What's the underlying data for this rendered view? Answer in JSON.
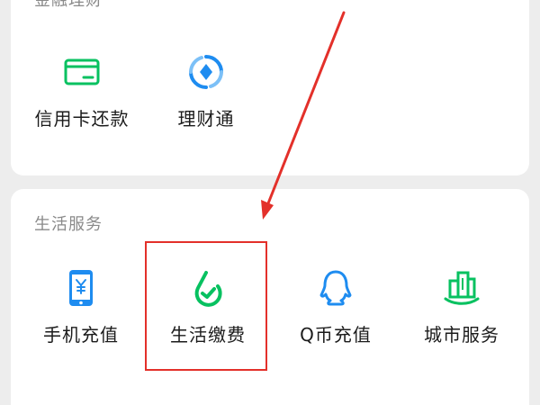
{
  "finance": {
    "title": "金融理财",
    "items": [
      {
        "label": "信用卡还款",
        "icon": "credit-card-icon"
      },
      {
        "label": "理财通",
        "icon": "wealth-icon"
      }
    ]
  },
  "life_services": {
    "title": "生活服务",
    "items": [
      {
        "label": "手机充值",
        "icon": "phone-icon"
      },
      {
        "label": "生活缴费",
        "icon": "bill-pay-icon"
      },
      {
        "label": "Q币充值",
        "icon": "qq-icon"
      },
      {
        "label": "城市服务",
        "icon": "city-icon"
      }
    ]
  },
  "colors": {
    "green": "#07c160",
    "blue": "#1e8cf0",
    "annotation_red": "#e3302a",
    "background": "#ededed"
  }
}
